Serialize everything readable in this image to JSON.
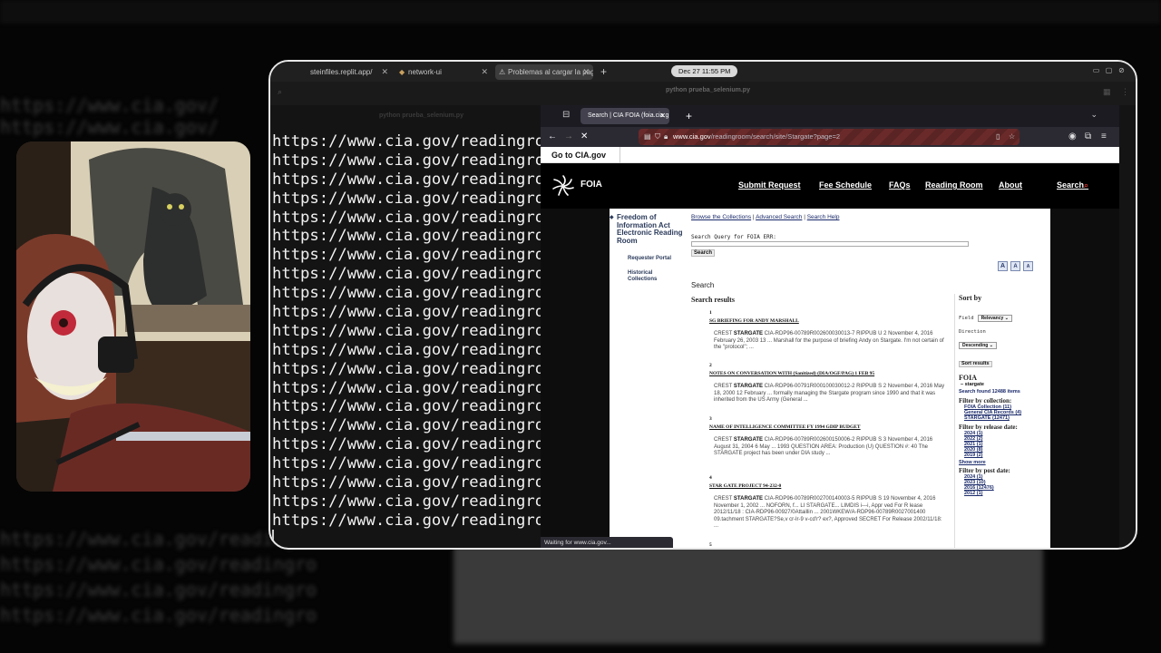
{
  "background": {
    "lines": [
      "https://www.cia.gov/",
      "https://www.cia.gov/",
      "https://www.cia.gov/readingro",
      "https://www.cia.gov/readingro",
      "https://www.cia.gov/readingro",
      "https://www.cia.gov/readingro"
    ]
  },
  "os": {
    "tabs": [
      {
        "label": "steinfiles.replit.app/"
      },
      {
        "label": "network-ui"
      },
      {
        "label": "Problemas al cargar la pagin"
      }
    ],
    "clock": "Dec 27  11:55 PM",
    "terminal_title": "python prueba_selenium.py",
    "terminal_subtitle": "python prueba_selenium.py"
  },
  "terminal": {
    "lines": [
      "https://www.cia.gov/readingroom",
      "https://www.cia.gov/readingroom",
      "https://www.cia.gov/readingroom",
      "https://www.cia.gov/readingroom",
      "https://www.cia.gov/readingroom",
      "https://www.cia.gov/readingroom",
      "https://www.cia.gov/readingroom",
      "https://www.cia.gov/readingroom",
      "https://www.cia.gov/readingroom",
      "https://www.cia.gov/readingroom",
      "https://www.cia.gov/readingroom",
      "https://www.cia.gov/readingroom",
      "https://www.cia.gov/readingroom",
      "https://www.cia.gov/readingroom",
      "https://www.cia.gov/readingroom",
      "https://www.cia.gov/readingroom",
      "https://www.cia.gov/readingroom",
      "https://www.cia.gov/readingroom",
      "https://www.cia.gov/readingroom",
      "https://www.cia.gov/readingroom",
      "https://www.cia.gov/readingroom"
    ]
  },
  "browser": {
    "tab_label": "Search | CIA FOIA (foia.cia.g",
    "url_host": "www.cia.gov",
    "url_path": "/readingroom/search/site/Stargate?page=2",
    "status": "Waiting for www.cia.gov..."
  },
  "cia": {
    "goto": "Go to CIA.gov",
    "logo_text": "FOIA",
    "nav": [
      "Submit Request",
      "Fee Schedule",
      "FAQs",
      "Reading Room",
      "About"
    ],
    "search": "Search",
    "leftnav_main": "Freedom of Information Act Electronic Reading Room",
    "leftnav_sub1": "Requester Portal",
    "leftnav_sub2": "Historical Collections",
    "crumbs": [
      "Browse the Collections",
      "Advanced Search",
      "Search Help"
    ],
    "query_label": "Search Query for FOIA ERR:",
    "search_button": "Search",
    "search_heading": "Search",
    "results_heading": "Search results",
    "results": [
      {
        "num": "1",
        "title": "SG BRIEFING FOR ANDY MARSHALL",
        "desc_pre": "CREST ",
        "desc_hl": "STARGATE",
        "desc_rest": " CIA-RDP96-00789R002600030013-7 RIPPUB U 2 November 4, 2016 February 26, 2003 13 ... Marshall for the purpose of briefing Andy on Stargate. I'm not certain of the \"protocol\"; ..."
      },
      {
        "num": "2",
        "title": "NOTES ON CONVERSATION WITH (Sanitized) (DIA/OGF/PAG) 1 FEB 95",
        "desc_pre": "CREST ",
        "desc_hl": "STARGATE",
        "desc_rest": " CIA-RDP96-00791R000100030012-2 RIPPUB S 2 November 4, 2016 May 18, 2000 12 February ... formally managing the Stargate program since 1990 and that it was inherited from the US Army (General ..."
      },
      {
        "num": "3",
        "title": "NAME OF INTELLIGENCE COMMITTEE FY 1994 GDIP BUDGET",
        "desc_pre": "CREST ",
        "desc_hl": "STARGATE",
        "desc_rest": " CIA-RDP96-00789R002600150006-2 RIPPUB S 3 November 4, 2016 August 31, 2004 6 May ... 1993 QUESTION AREA: Production (U) QUESTION #: 40 The STARGATE project has been under DIA study ..."
      },
      {
        "num": "4",
        "title": "STAR GATE PROJECT 94-232-0",
        "desc_pre": "CREST ",
        "desc_hl": "STARGATE",
        "desc_rest": " CIA-RDP96-00789R002700140003-5 RIPPUB S 19 November 4, 2016 November 1, 2002 ... NOFORN, f... LI STARGATE... LIMDIS i---i, Appr ved For R lease 2012/11/18 : CIA-RDP96-00927/0Attaillin ... 2001WKEW/A-RDP96-00789R0027001400 09.tachment STARGATE?Se,v cr-lr-9 v-cd'r? ex?, Approved SECRET For Release 2002/11/18: ..."
      },
      {
        "num": "5",
        "title": "",
        "desc_pre": "",
        "desc_hl": "",
        "desc_rest": ""
      }
    ],
    "sort_by": "Sort by",
    "field_label": "Field",
    "field_value": "Relevancy",
    "direction_label": "Direction",
    "direction_value": "Descending",
    "sort_button": "Sort results",
    "foia_heading": "FOIA",
    "foia_term": "stargate",
    "found": "Search found 12488 items",
    "filter_collection": "Filter by collection:",
    "collections": [
      "FOIA Collection (11)",
      "General CIA Records (4)",
      "STARGATE (12471)"
    ],
    "filter_release": "Filter by release date:",
    "release_dates": [
      "2024 (1)",
      "2022 (2)",
      "2021 (1)",
      "2020 (8)",
      "2019 (2)"
    ],
    "show_more": "Show more",
    "filter_post": "Filter by post date:",
    "post_dates": [
      "2024 (1)",
      "2023 (10)",
      "2016 (12476)",
      "2012 (1)"
    ]
  }
}
